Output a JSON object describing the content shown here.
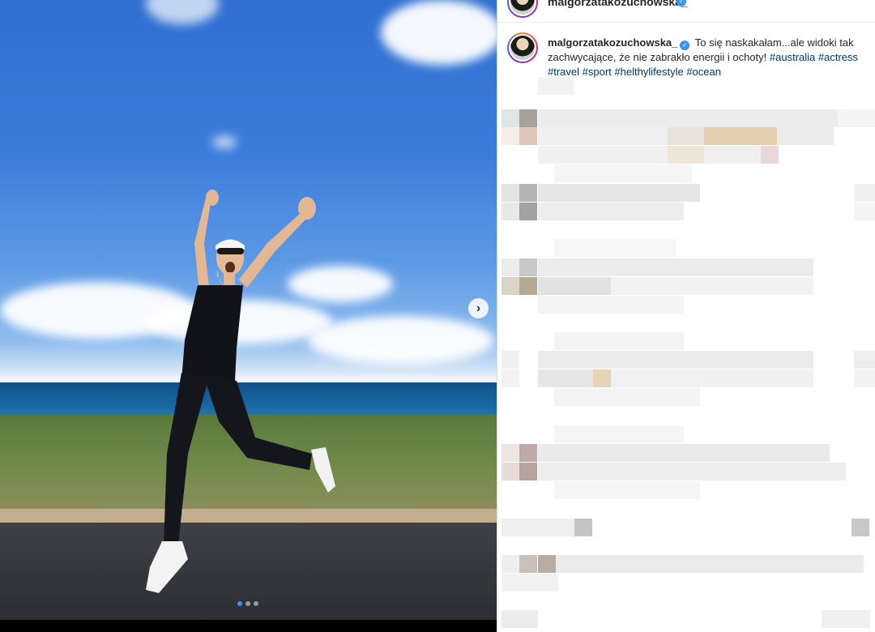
{
  "post": {
    "username": "malgorzatakozuchowska_",
    "verified_icon": "verified-badge-icon",
    "caption_text": "To się naskakałam...ale widoki tak zachwycające, że nie zabrakło energii i ochoty!",
    "hashtags": [
      "#australia",
      "#actress",
      "#travel",
      "#sport",
      "#helthylifestyle",
      "#ocean"
    ],
    "more_icon": "more-options-icon"
  },
  "carousel": {
    "next_icon": "chevron-right-icon",
    "slides_total": 3,
    "current_slide": 1
  },
  "colors": {
    "accent": "#3897f0",
    "hashtag": "#00376b"
  }
}
